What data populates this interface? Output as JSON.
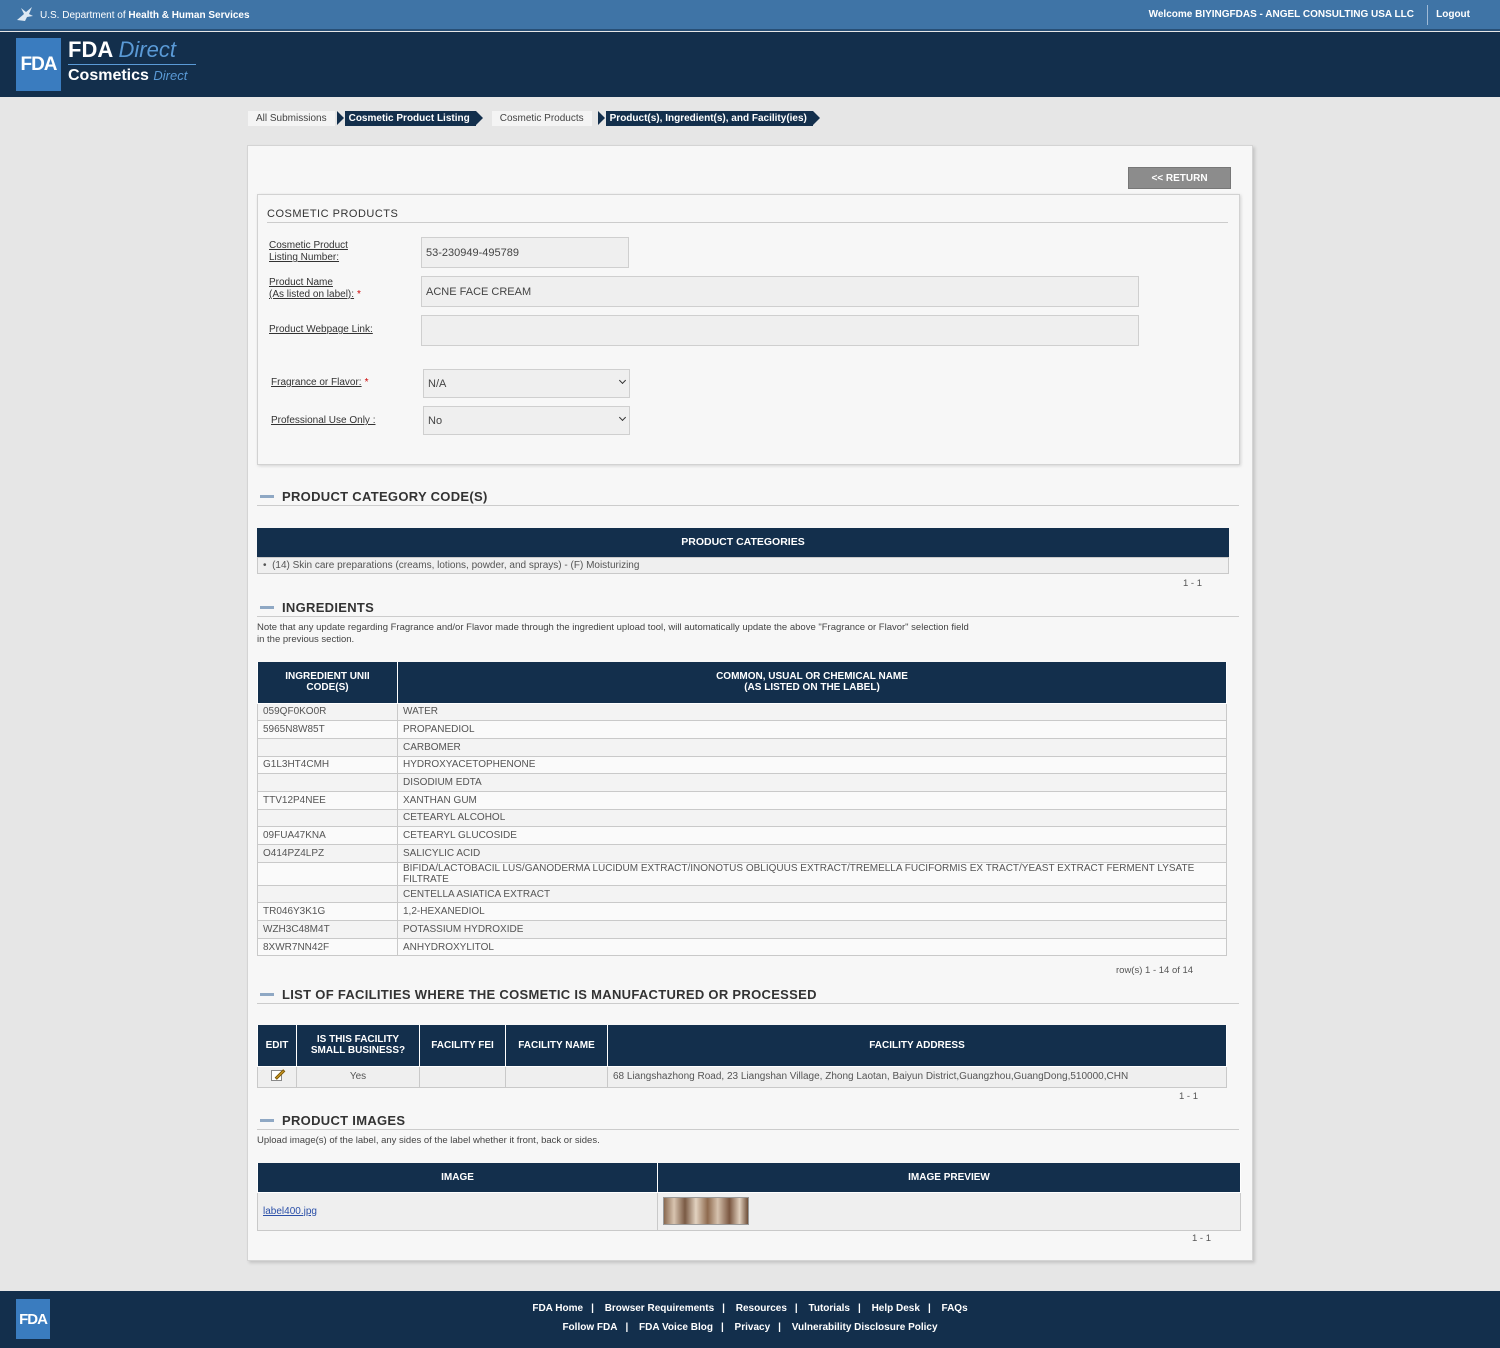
{
  "gov_bar": {
    "hhs_prefix": "U.S. Department of ",
    "hhs_bold": "Health & Human Services",
    "welcome": "Welcome BIYINGFDAS - ANGEL CONSULTING USA LLC",
    "logout": "Logout"
  },
  "header": {
    "fda": "FDA",
    "brand_fda": "FDA",
    "brand_direct": "Direct",
    "brand_cosmetics": "Cosmetics",
    "brand_direct2": "Direct"
  },
  "breadcrumb": [
    "All Submissions",
    "Cosmetic Product Listing",
    "Cosmetic Products",
    "Product(s), Ingredient(s), and Facility(ies)"
  ],
  "return_label": "<< RETURN",
  "cosmetic_products": {
    "title": "COSMETIC PRODUCTS",
    "listing_number_label_1": "Cosmetic Product",
    "listing_number_label_2": "Listing Number:",
    "listing_number": "53-230949-495789",
    "product_name_label_1": "Product Name",
    "product_name_label_2": "(As listed on label):",
    "product_name": "ACNE FACE CREAM",
    "webpage_label": "Product Webpage Link:",
    "webpage": "",
    "fragrance_label": "Fragrance or Flavor:",
    "fragrance_value": "N/A",
    "professional_label": "Professional Use Only :",
    "professional_value": "No",
    "required_mark": "*"
  },
  "categories": {
    "heading": "PRODUCT CATEGORY CODE(S)",
    "table_header": "PRODUCT CATEGORIES",
    "items": [
      "(14) Skin care preparations (creams, lotions, powder, and sprays) - (F) Moisturizing"
    ],
    "pager": "1 - 1"
  },
  "ingredients": {
    "heading": "INGREDIENTS",
    "note_1": "Note that any update regarding Fragrance and/or Flavor made through the ingredient upload tool, will automatically update the above \"Fragrance or Flavor\" selection field",
    "note_2": "in the previous section.",
    "col1_l1": "INGREDIENT UNII",
    "col1_l2": "CODE(S)",
    "col2_l1": "COMMON, USUAL OR CHEMICAL NAME",
    "col2_l2": "(AS LISTED ON THE LABEL)",
    "rows": [
      {
        "code": "059QF0KO0R",
        "name": "WATER"
      },
      {
        "code": "5965N8W85T",
        "name": "PROPANEDIOL"
      },
      {
        "code": "",
        "name": "CARBOMER"
      },
      {
        "code": "G1L3HT4CMH",
        "name": "HYDROXYACETOPHENONE"
      },
      {
        "code": "",
        "name": "DISODIUM EDTA"
      },
      {
        "code": "TTV12P4NEE",
        "name": "XANTHAN GUM"
      },
      {
        "code": "",
        "name": "CETEARYL ALCOHOL"
      },
      {
        "code": "09FUA47KNA",
        "name": "CETEARYL GLUCOSIDE"
      },
      {
        "code": "O414PZ4LPZ",
        "name": "SALICYLIC ACID"
      },
      {
        "code": "",
        "name": "BIFIDA/LACTOBACIL LUS/GANODERMA LUCIDUM EXTRACT/INONOTUS OBLIQUUS EXTRACT/TREMELLA FUCIFORMIS EX TRACT/YEAST EXTRACT FERMENT LYSATE FILTRATE"
      },
      {
        "code": "",
        "name": "CENTELLA ASIATICA EXTRACT"
      },
      {
        "code": "TR046Y3K1G",
        "name": "1,2-HEXANEDIOL"
      },
      {
        "code": "WZH3C48M4T",
        "name": "POTASSIUM HYDROXIDE"
      },
      {
        "code": "8XWR7NN42F",
        "name": "ANHYDROXYLITOL"
      }
    ],
    "pager": "row(s) 1 - 14 of 14"
  },
  "facilities": {
    "heading": "LIST OF FACILITIES WHERE THE COSMETIC IS MANUFACTURED OR PROCESSED",
    "col_edit": "EDIT",
    "col_small_l1": "IS THIS FACILITY",
    "col_small_l2": "SMALL BUSINESS?",
    "col_fei": "FACILITY FEI",
    "col_name": "FACILITY NAME",
    "col_address": "FACILITY ADDRESS",
    "rows": [
      {
        "small_business": "Yes",
        "fei": "",
        "name": "",
        "address": "68 Liangshazhong Road, 23 Liangshan Village, Zhong Laotan, Baiyun District,Guangzhou,GuangDong,510000,CHN"
      }
    ],
    "pager": "1 - 1"
  },
  "images": {
    "heading": "PRODUCT IMAGES",
    "note": "Upload image(s) of the label, any sides of the label whether it front, back or sides.",
    "col_image": "IMAGE",
    "col_preview": "IMAGE PREVIEW",
    "rows": [
      {
        "file": "label400.jpg"
      }
    ],
    "pager": "1 - 1"
  },
  "footer": {
    "logo": "FDA",
    "row1": [
      "FDA Home",
      "Browser Requirements",
      "Resources",
      "Tutorials",
      "Help Desk",
      "FAQs"
    ],
    "row2": [
      "Follow FDA",
      "FDA Voice Blog",
      "Privacy",
      "Vulnerability Disclosure Policy"
    ],
    "separator": "|"
  }
}
